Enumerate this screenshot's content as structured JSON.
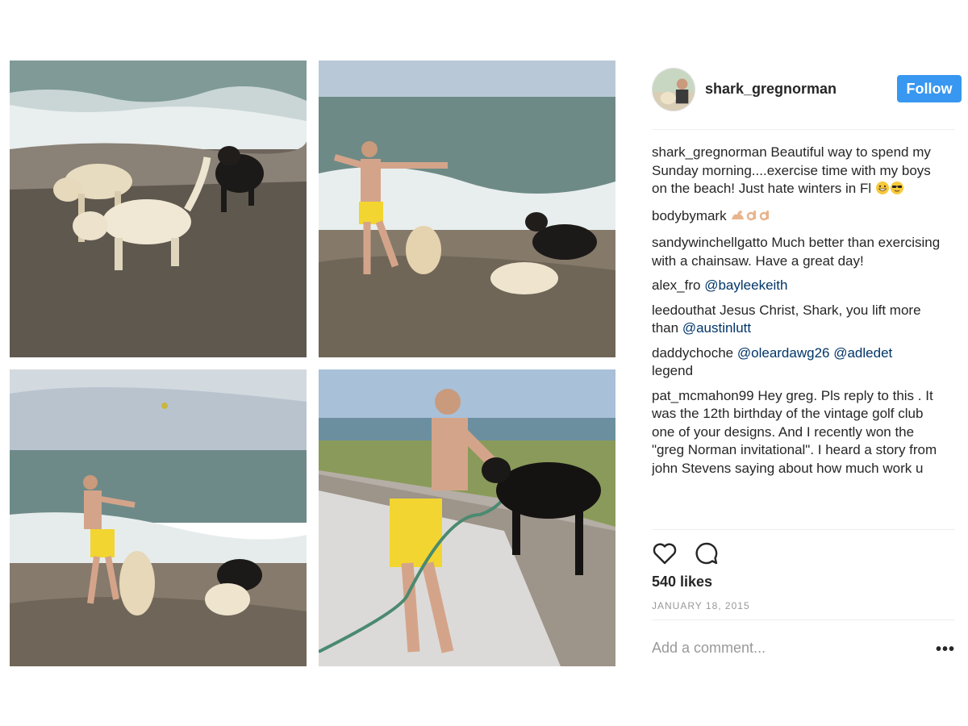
{
  "post": {
    "username": "shark_gregnorman",
    "follow_label": "Follow",
    "likes": "540 likes",
    "date": "JANUARY 18, 2015",
    "add_comment_placeholder": "Add a comment...",
    "more_label": "•••"
  },
  "photos": [
    {
      "description_name": "photo-dogs-in-surf"
    },
    {
      "description_name": "photo-man-throwing-ball"
    },
    {
      "description_name": "photo-man-throwing-ball-2"
    },
    {
      "description_name": "photo-man-hosing-dog"
    }
  ],
  "comments": [
    {
      "user": "shark_gregnorman",
      "text": " Beautiful way to spend my Sunday morning....exercise time with my boys on the beach! Just hate winters in Fl ",
      "emojis": [
        "grin-face",
        "sunglasses-face"
      ]
    },
    {
      "user": "bodybymark",
      "text": " ",
      "emojis": [
        "flexed-biceps",
        "ok-hand",
        "ok-hand"
      ]
    },
    {
      "user": "sandywinchellgatto",
      "text": " Much better than exercising with a chainsaw. Have a great day!"
    },
    {
      "user": "alex_fro",
      "text": " ",
      "mention1": "@bayleekeith"
    },
    {
      "user": "leedouthat",
      "text": " Jesus Christ, Shark, you lift more than ",
      "mention1": "@austinlutt"
    },
    {
      "user": "daddychoche",
      "text": " ",
      "mention1": "@oleardawg26",
      "mention2": "@adledet",
      "tail": " legend"
    },
    {
      "user": "pat_mcmahon99",
      "text": " Hey greg. Pls reply to this . It was the 12th birthday of the vintage golf club one of your designs. And I recently won the \"greg Norman invitational\". I heard a story from john Stevens saying about how much work u"
    }
  ],
  "colors": {
    "follow_bg": "#3897f0",
    "mention": "#003569",
    "muted": "#999999"
  },
  "icons": [
    "heart-icon",
    "comment-icon"
  ]
}
